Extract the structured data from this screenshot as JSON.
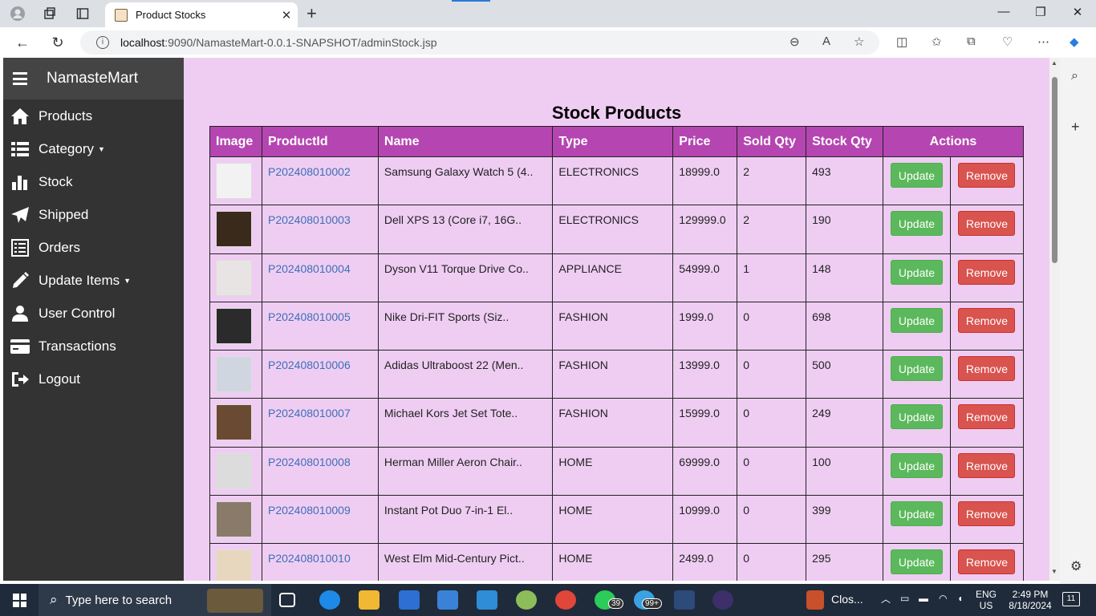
{
  "browser": {
    "tab_title": "Product Stocks",
    "url_host": "localhost",
    "url_path": ":9090/NamasteMart-0.0.1-SNAPSHOT/adminStock.jsp"
  },
  "sidebar": {
    "brand": "NamasteMart",
    "items": [
      {
        "label": "Products",
        "icon": "home-icon"
      },
      {
        "label": "Category",
        "icon": "list-icon",
        "dropdown": true
      },
      {
        "label": "Stock",
        "icon": "bar-chart-icon"
      },
      {
        "label": "Shipped",
        "icon": "paper-plane-icon"
      },
      {
        "label": "Orders",
        "icon": "list-alt-icon"
      },
      {
        "label": "Update Items",
        "icon": "pencil-icon",
        "dropdown": true
      },
      {
        "label": "User Control",
        "icon": "user-icon"
      },
      {
        "label": "Transactions",
        "icon": "credit-card-icon"
      },
      {
        "label": "Logout",
        "icon": "logout-icon"
      }
    ]
  },
  "main": {
    "title": "Stock Products",
    "columns": [
      "Image",
      "ProductId",
      "Name",
      "Type",
      "Price",
      "Sold Qty",
      "Stock Qty",
      "Actions"
    ],
    "update_label": "Update",
    "remove_label": "Remove",
    "rows": [
      {
        "id": "P202408010002",
        "name": "Samsung Galaxy Watch 5 (4..",
        "type": "ELECTRONICS",
        "price": "18999.0",
        "sold": "2",
        "stock": "493",
        "thumb": "#f2f2f2"
      },
      {
        "id": "P202408010003",
        "name": "Dell XPS 13 (Core i7, 16G..",
        "type": "ELECTRONICS",
        "price": "129999.0",
        "sold": "2",
        "stock": "190",
        "thumb": "#3a2a1c"
      },
      {
        "id": "P202408010004",
        "name": "Dyson V11 Torque Drive Co..",
        "type": "APPLIANCE",
        "price": "54999.0",
        "sold": "1",
        "stock": "148",
        "thumb": "#e9e4e4"
      },
      {
        "id": "P202408010005",
        "name": "Nike Dri-FIT Sports (Siz..",
        "type": "FASHION",
        "price": "1999.0",
        "sold": "0",
        "stock": "698",
        "thumb": "#2b2b2b"
      },
      {
        "id": "P202408010006",
        "name": "Adidas Ultraboost 22 (Men..",
        "type": "FASHION",
        "price": "13999.0",
        "sold": "0",
        "stock": "500",
        "thumb": "#cfd6e0"
      },
      {
        "id": "P202408010007",
        "name": "Michael Kors Jet Set Tote..",
        "type": "FASHION",
        "price": "15999.0",
        "sold": "0",
        "stock": "249",
        "thumb": "#6b4a33"
      },
      {
        "id": "P202408010008",
        "name": "Herman Miller Aeron Chair..",
        "type": "HOME",
        "price": "69999.0",
        "sold": "0",
        "stock": "100",
        "thumb": "#dcdcdc"
      },
      {
        "id": "P202408010009",
        "name": "Instant Pot Duo 7-in-1 El..",
        "type": "HOME",
        "price": "10999.0",
        "sold": "0",
        "stock": "399",
        "thumb": "#8a7a6a"
      },
      {
        "id": "P202408010010",
        "name": "West Elm Mid-Century Pict..",
        "type": "HOME",
        "price": "2499.0",
        "sold": "0",
        "stock": "295",
        "thumb": "#e8d7bf"
      }
    ]
  },
  "taskbar": {
    "search_placeholder": "Type here to search",
    "whatsapp_badge": "39",
    "telegram_badge": "99+",
    "closing_label": "Clos...",
    "lang": "ENG",
    "region": "US",
    "time": "2:49 PM",
    "date": "8/18/2024",
    "notifications": "11"
  }
}
